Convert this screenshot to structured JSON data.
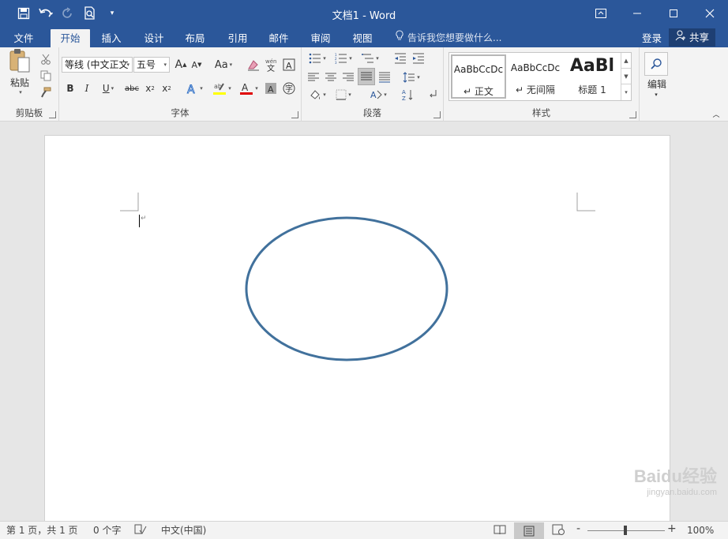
{
  "window": {
    "title": "文档1 - Word",
    "controls": {
      "ribbon_display": "ribbon-display-icon",
      "minimize": "minimize-icon",
      "maximize": "maximize-icon",
      "close": "close-icon"
    }
  },
  "qat": {
    "icons": [
      "save-icon",
      "undo-icon",
      "redo-icon",
      "print-preview-icon",
      "customize-qat-icon"
    ],
    "dropdown_caret": "▾"
  },
  "tabs": [
    {
      "label": "文件"
    },
    {
      "label": "开始"
    },
    {
      "label": "插入"
    },
    {
      "label": "设计"
    },
    {
      "label": "布局"
    },
    {
      "label": "引用"
    },
    {
      "label": "邮件"
    },
    {
      "label": "审阅"
    },
    {
      "label": "视图"
    }
  ],
  "active_tab": "开始",
  "tell_me": "告诉我您想要做什么...",
  "account": {
    "login": "登录",
    "share": "共享"
  },
  "ribbon": {
    "clipboard": {
      "label": "剪贴板",
      "paste": "粘贴"
    },
    "font": {
      "label": "字体",
      "font_name": "等线 (中文正文",
      "font_size": "五号",
      "grow": "A",
      "shrink": "A",
      "change_case": "Aa",
      "bold": "B",
      "italic": "I",
      "underline": "U",
      "strike": "abc",
      "subscript": "x",
      "superscript": "x",
      "highlight_color": "#ffff00",
      "font_color": "#e00000"
    },
    "paragraph": {
      "label": "段落"
    },
    "styles": {
      "label": "样式",
      "items": [
        {
          "sample": "AaBbCcDc",
          "name": "正文"
        },
        {
          "sample": "AaBbCcDc",
          "name": "无间隔"
        },
        {
          "sample": "AaBl",
          "name": "标题 1"
        }
      ]
    },
    "editing": {
      "label": "编辑"
    }
  },
  "document": {
    "shape": {
      "type": "ellipse",
      "stroke_color": "#41719c"
    }
  },
  "status": {
    "page": "第 1 页，共 1 页",
    "words": "0 个字",
    "language": "中文(中国)",
    "zoom": "100%",
    "zoom_minus": "-",
    "zoom_plus": "+"
  },
  "watermark": {
    "brand": "Baidu经验",
    "url": "jingyan.baidu.com"
  },
  "colors": {
    "accent": "#2b579a"
  }
}
